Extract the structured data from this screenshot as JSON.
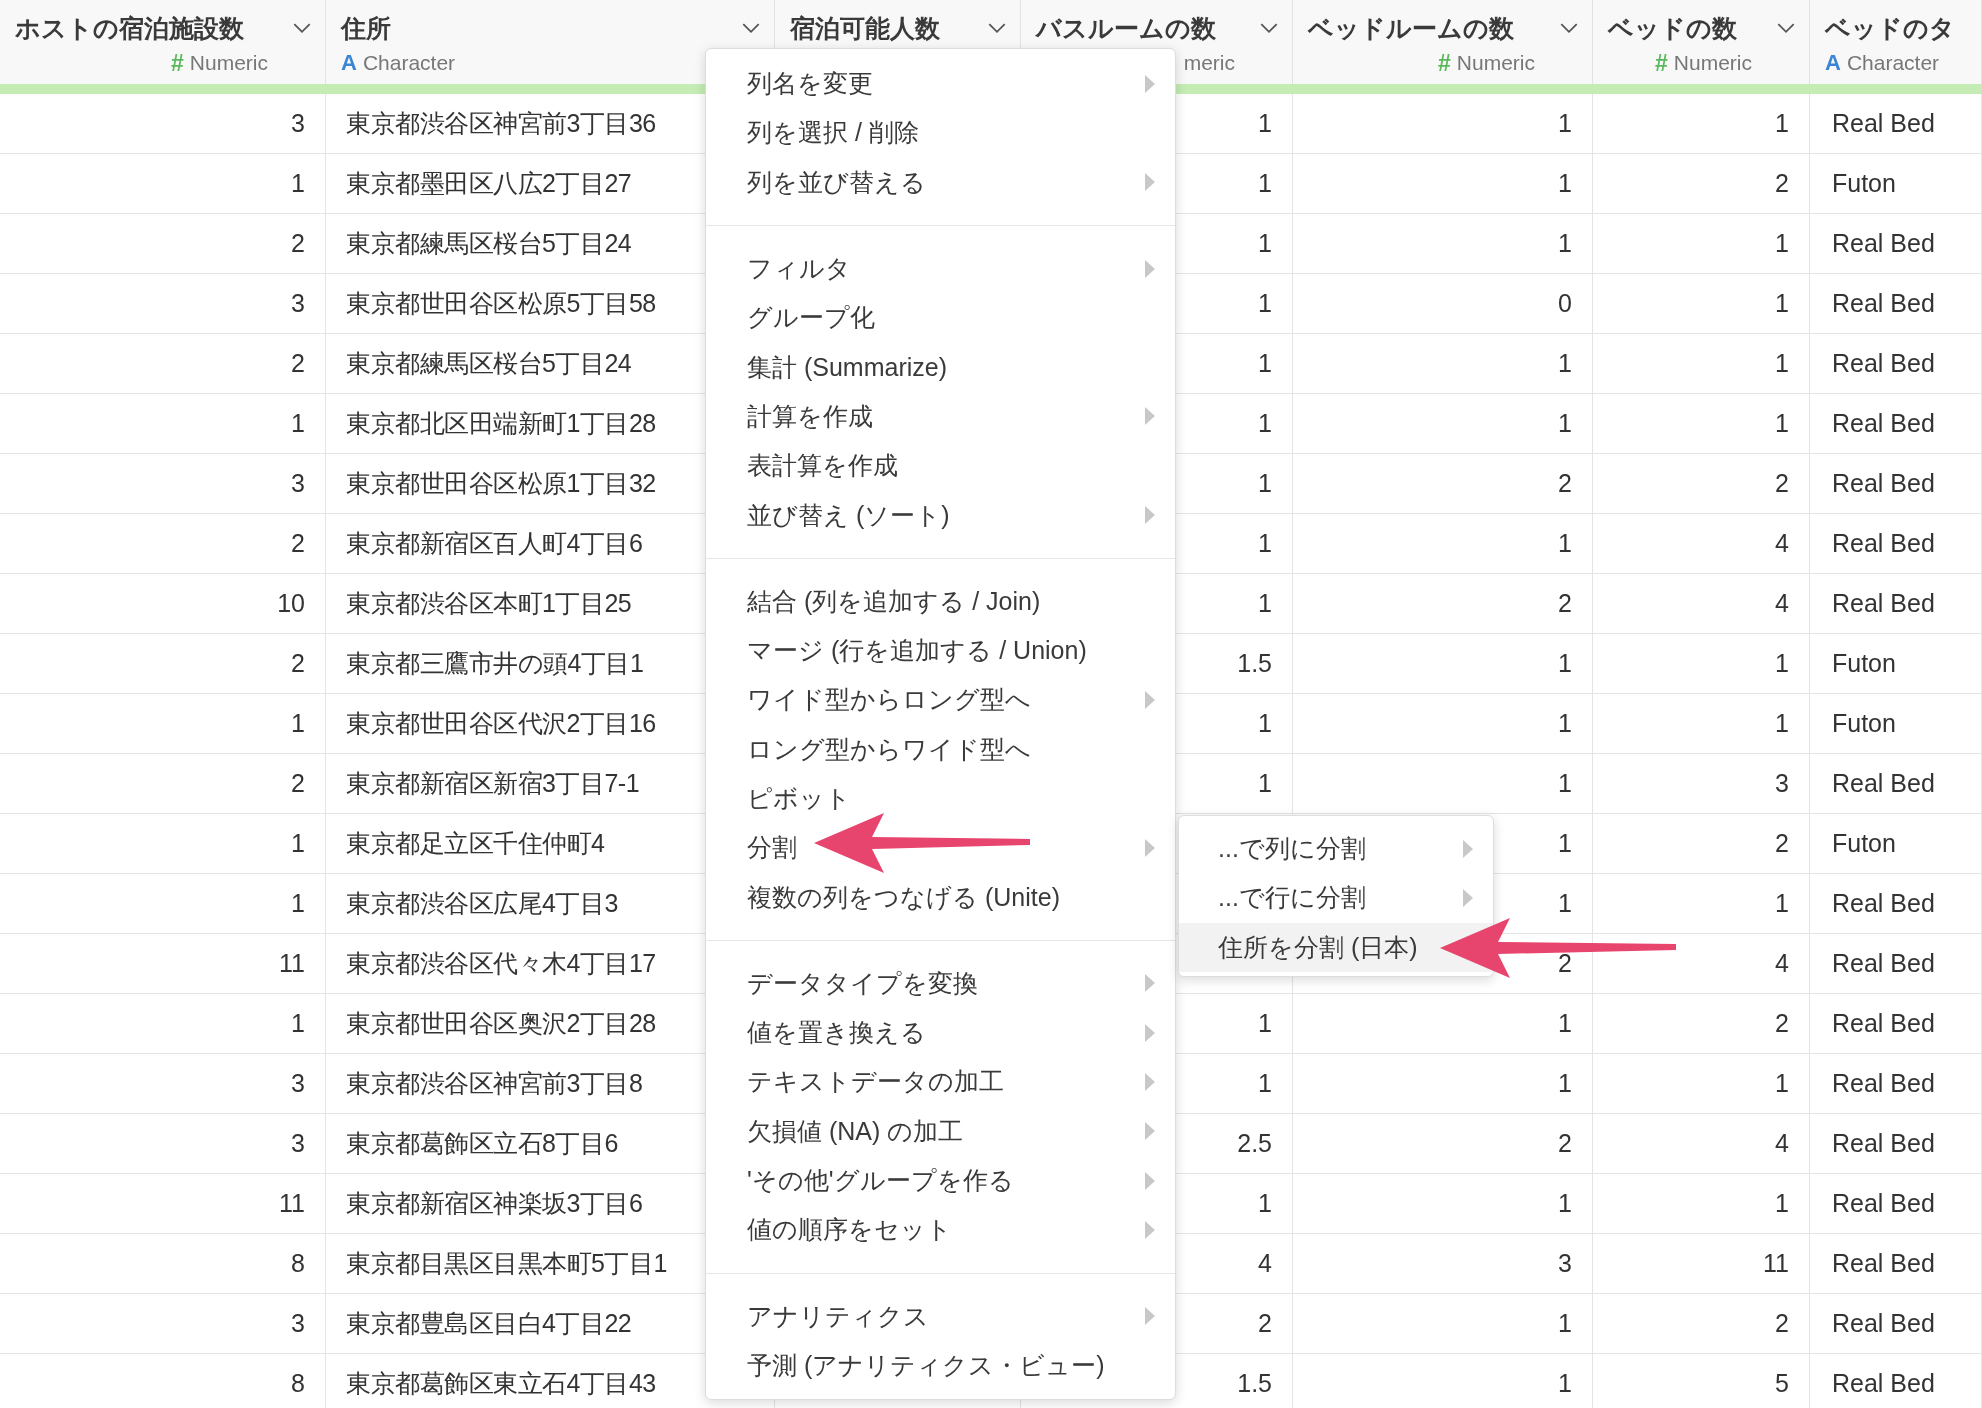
{
  "table": {
    "columns": [
      {
        "title": "ホストの宿泊施設数",
        "dropdown": true,
        "type": {
          "kind": "numeric",
          "icon": "#",
          "label": "Numeric"
        }
      },
      {
        "title": "住所",
        "dropdown": true,
        "type": {
          "kind": "character",
          "icon": "A",
          "label": "Character"
        }
      },
      {
        "title": "宿泊可能人数",
        "dropdown": true
      },
      {
        "title": "バスルームの数",
        "dropdown": true,
        "type": {
          "label": "meric"
        }
      },
      {
        "title": "ベッドルームの数",
        "dropdown": true,
        "type": {
          "kind": "numeric",
          "icon": "#",
          "label": "Numeric"
        }
      },
      {
        "title": "ベッドの数",
        "dropdown": true,
        "type": {
          "kind": "numeric",
          "icon": "#",
          "label": "Numeric"
        }
      },
      {
        "title": "ベッドのタ",
        "dropdown": false,
        "type": {
          "kind": "character",
          "icon": "A",
          "label": "Character"
        }
      }
    ],
    "rows": [
      [
        "3",
        "東京都渋谷区神宮前3丁目36",
        null,
        "1",
        "1",
        "1",
        "Real Bed"
      ],
      [
        "1",
        "東京都墨田区八広2丁目27",
        null,
        "1",
        "1",
        "2",
        "Futon"
      ],
      [
        "2",
        "東京都練馬区桜台5丁目24",
        null,
        "1",
        "1",
        "1",
        "Real Bed"
      ],
      [
        "3",
        "東京都世田谷区松原5丁目58",
        null,
        "1",
        "0",
        "1",
        "Real Bed"
      ],
      [
        "2",
        "東京都練馬区桜台5丁目24",
        null,
        "1",
        "1",
        "1",
        "Real Bed"
      ],
      [
        "1",
        "東京都北区田端新町1丁目28",
        null,
        "1",
        "1",
        "1",
        "Real Bed"
      ],
      [
        "3",
        "東京都世田谷区松原1丁目32",
        null,
        "1",
        "2",
        "2",
        "Real Bed"
      ],
      [
        "2",
        "東京都新宿区百人町4丁目6",
        null,
        "1",
        "1",
        "4",
        "Real Bed"
      ],
      [
        "10",
        "東京都渋谷区本町1丁目25",
        null,
        "1",
        "2",
        "4",
        "Real Bed"
      ],
      [
        "2",
        "東京都三鷹市井の頭4丁目1",
        null,
        "1.5",
        "1",
        "1",
        "Futon"
      ],
      [
        "1",
        "東京都世田谷区代沢2丁目16",
        null,
        "1",
        "1",
        "1",
        "Futon"
      ],
      [
        "2",
        "東京都新宿区新宿3丁目7-1",
        null,
        "1",
        "1",
        "3",
        "Real Bed"
      ],
      [
        "1",
        "東京都足立区千住仲町4",
        null,
        null,
        "1",
        "2",
        "Futon"
      ],
      [
        "1",
        "東京都渋谷区広尾4丁目3",
        null,
        null,
        "1",
        "1",
        "Real Bed"
      ],
      [
        "11",
        "東京都渋谷区代々木4丁目17",
        null,
        null,
        "2",
        "4",
        "Real Bed"
      ],
      [
        "1",
        "東京都世田谷区奥沢2丁目28",
        null,
        "1",
        "1",
        "2",
        "Real Bed"
      ],
      [
        "3",
        "東京都渋谷区神宮前3丁目8",
        null,
        "1",
        "1",
        "1",
        "Real Bed"
      ],
      [
        "3",
        "東京都葛飾区立石8丁目6",
        null,
        "2.5",
        "2",
        "4",
        "Real Bed"
      ],
      [
        "11",
        "東京都新宿区神楽坂3丁目6",
        null,
        "1",
        "1",
        "1",
        "Real Bed"
      ],
      [
        "8",
        "東京都目黒区目黒本町5丁目1",
        null,
        "4",
        "3",
        "11",
        "Real Bed"
      ],
      [
        "3",
        "東京都豊島区目白4丁目22",
        null,
        "2",
        "1",
        "2",
        "Real Bed"
      ],
      [
        "8",
        "東京都葛飾区東立石4丁目43",
        null,
        "1.5",
        "1",
        "5",
        "Real Bed"
      ]
    ]
  },
  "context_menu": {
    "groups": [
      [
        {
          "label": "列名を変更",
          "submenu": true
        },
        {
          "label": "列を選択 / 削除",
          "submenu": false
        },
        {
          "label": "列を並び替える",
          "submenu": true
        }
      ],
      [
        {
          "label": "フィルタ",
          "submenu": true
        },
        {
          "label": "グループ化",
          "submenu": false
        },
        {
          "label": "集計 (Summarize)",
          "submenu": false
        },
        {
          "label": "計算を作成",
          "submenu": true
        },
        {
          "label": "表計算を作成",
          "submenu": false
        },
        {
          "label": "並び替え (ソート)",
          "submenu": true
        }
      ],
      [
        {
          "label": "結合 (列を追加する / Join)",
          "submenu": false
        },
        {
          "label": "マージ (行を追加する / Union)",
          "submenu": false
        },
        {
          "label": "ワイド型からロング型へ",
          "submenu": true
        },
        {
          "label": "ロング型からワイド型へ",
          "submenu": false
        },
        {
          "label": "ピボット",
          "submenu": false
        },
        {
          "label": "分割",
          "submenu": true
        },
        {
          "label": "複数の列をつなげる (Unite)",
          "submenu": false
        }
      ],
      [
        {
          "label": "データタイプを変換",
          "submenu": true
        },
        {
          "label": "値を置き換える",
          "submenu": true
        },
        {
          "label": "テキストデータの加工",
          "submenu": true
        },
        {
          "label": "欠損値 (NA) の加工",
          "submenu": true
        },
        {
          "label": "'その他'グループを作る",
          "submenu": true
        },
        {
          "label": "値の順序をセット",
          "submenu": true
        }
      ],
      [
        {
          "label": "アナリティクス",
          "submenu": true
        },
        {
          "label": "予測 (アナリティクス・ビュー)",
          "submenu": false
        }
      ]
    ]
  },
  "submenu": {
    "items": [
      {
        "label": "...で列に分割",
        "submenu": true,
        "selected": false
      },
      {
        "label": "...で行に分割",
        "submenu": true,
        "selected": false
      },
      {
        "label": "住所を分割 (日本)",
        "submenu": false,
        "selected": true
      }
    ]
  }
}
